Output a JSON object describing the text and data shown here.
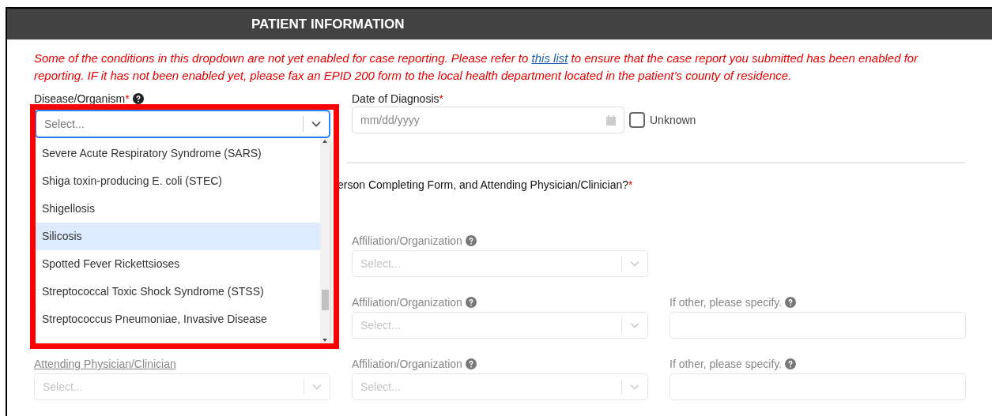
{
  "header": {
    "title": "PATIENT INFORMATION"
  },
  "notice": {
    "before": "Some of the conditions in this dropdown are not yet enabled for case reporting. Please refer to ",
    "link": "this list",
    "after": " to ensure that the case report you submitted has been enabled for reporting. IF it has not been enabled yet, please fax an EPID 200 form to the local health department located in the patient’s county of residence."
  },
  "disease_field": {
    "label": "Disease/Organism",
    "required_mark": "*",
    "placeholder": "Select...",
    "focused": true
  },
  "date_field": {
    "label": "Date of Diagnosis",
    "required_mark": "*",
    "placeholder": "mm/dd/yyyy"
  },
  "unknown_checkbox": {
    "label": "Unknown",
    "checked": false
  },
  "question": {
    "text": "erson Completing Form, and Attending Physician/Clinician?",
    "required_mark": "*"
  },
  "contact_rows": [
    {
      "disabled": true,
      "affiliation": {
        "label": "Affiliation/Organization",
        "placeholder": "Select..."
      }
    },
    {
      "disabled": true,
      "affiliation": {
        "label": "Affiliation/Organization",
        "placeholder": "Select..."
      },
      "other": {
        "label": "If other, please specify."
      }
    },
    {
      "disabled": true,
      "contact": {
        "label": "Attending Physician/Clinician",
        "placeholder": "Select..."
      },
      "affiliation": {
        "label": "Affiliation/Organization",
        "placeholder": "Select..."
      },
      "other": {
        "label": "If other, please specify."
      }
    }
  ],
  "dropdown": {
    "options": [
      {
        "label": "Severe Acute Respiratory Syndrome (SARS)",
        "selected": false
      },
      {
        "label": "Shiga toxin-producing E. coli (STEC)",
        "selected": false
      },
      {
        "label": "Shigellosis",
        "selected": false
      },
      {
        "label": "Silicosis",
        "selected": true
      },
      {
        "label": "Spotted Fever Rickettsioses",
        "selected": false
      },
      {
        "label": "Streptococcal Toxic Shock Syndrome (STSS)",
        "selected": false
      },
      {
        "label": "Streptococcus Pneumoniae, Invasive Disease",
        "selected": false
      }
    ]
  }
}
